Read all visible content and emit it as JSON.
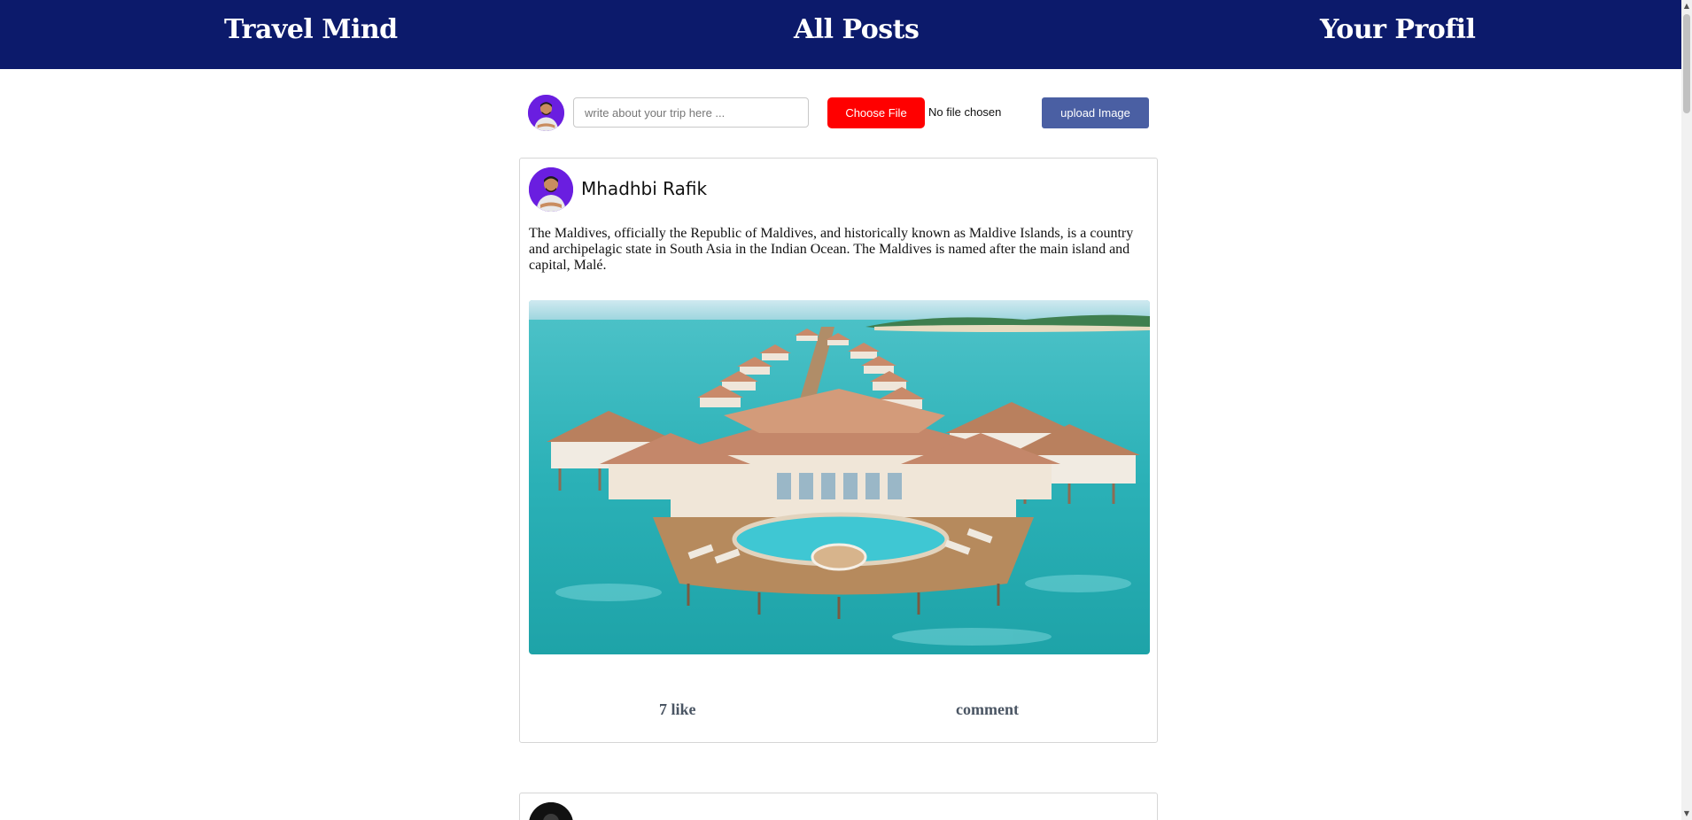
{
  "nav": {
    "brand": "Travel Mind",
    "all_posts": "All Posts",
    "profile": "Your Profil",
    "background_color": "#0c1a6b"
  },
  "composer": {
    "input_placeholder": "write about your trip here ...",
    "input_value": "",
    "choose_file_label": "Choose File",
    "no_file_text": "No file chosen",
    "upload_label": "upload Image",
    "choose_file_color": "#ff0000",
    "upload_color": "#4a5fa3"
  },
  "posts": [
    {
      "author": "Mhadhbi Rafik",
      "text": "The Maldives, officially the Republic of Maldives, and historically known as Maldive Islands, is a country and archipelagic state in South Asia in the Indian Ocean. The Maldives is named after the main island and capital, Malé.",
      "like_label": "7 like",
      "comment_label": "comment",
      "image_subject": "maldives-overwater-villas"
    },
    {
      "author": "",
      "avatar_color": "#111111"
    }
  ],
  "icons": {
    "scroll_up": "scroll-up-arrow",
    "scroll_down": "scroll-down-arrow"
  }
}
